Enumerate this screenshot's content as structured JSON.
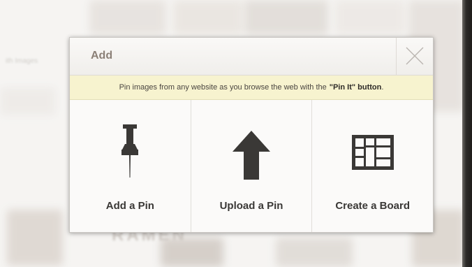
{
  "background": {
    "blurred_text": [
      "ith Images"
    ],
    "banner_word": "RAMEN"
  },
  "modal": {
    "title": "Add",
    "notice": {
      "text": "Pin images from any website as you browse the web with the",
      "highlight": "\"Pin It\" button",
      "suffix": "."
    },
    "options": [
      {
        "label": "Add a Pin",
        "icon": "pushpin-icon"
      },
      {
        "label": "Upload a Pin",
        "icon": "up-arrow-icon"
      },
      {
        "label": "Create a Board",
        "icon": "board-grid-icon"
      }
    ]
  },
  "colors": {
    "notice_bg": "#f7f3cf",
    "title": "#8b8077",
    "icon": "#3a3836"
  }
}
